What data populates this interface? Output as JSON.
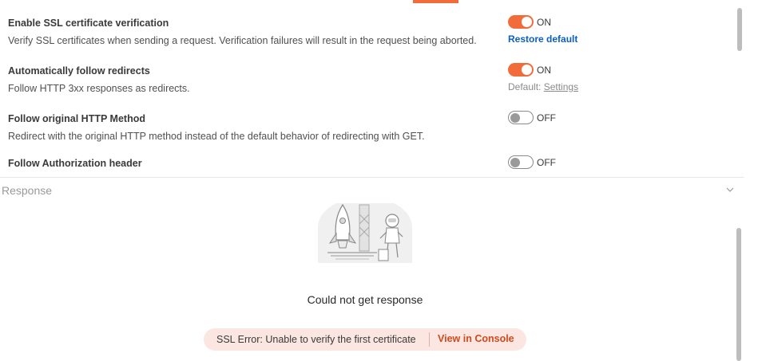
{
  "settings": {
    "ssl": {
      "title": "Enable SSL certificate verification",
      "description": "Verify SSL certificates when sending a request. Verification failures will result in the request being aborted.",
      "state": "ON",
      "restore_label": "Restore default"
    },
    "redirects": {
      "title": "Automatically follow redirects",
      "description": "Follow HTTP 3xx responses as redirects.",
      "state": "ON",
      "default_prefix": "Default:",
      "settings_link": "Settings"
    },
    "original_method": {
      "title": "Follow original HTTP Method",
      "description": "Redirect with the original HTTP method instead of the default behavior of redirecting with GET.",
      "state": "OFF"
    },
    "auth_header": {
      "title": "Follow Authorization header",
      "state": "OFF"
    }
  },
  "response": {
    "label": "Response",
    "message": "Could not get response",
    "error_text": "SSL Error: Unable to verify the first certificate",
    "console_link": "View in Console"
  },
  "colors": {
    "accent": "#f26b3a",
    "link": "#0b5fc4",
    "error_bg": "#fbe6e1",
    "error_link": "#d04a1d"
  }
}
